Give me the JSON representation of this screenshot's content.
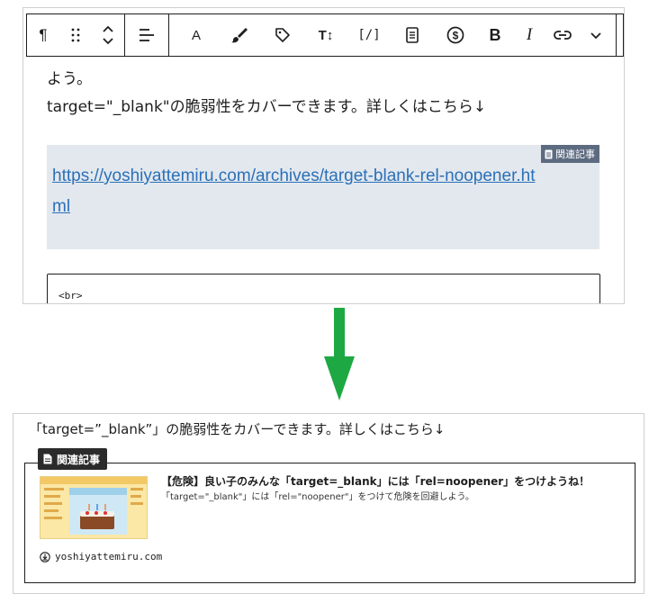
{
  "toolbar": {
    "paragraph_glyph": "¶",
    "drag_glyph": "⠿",
    "align_icon": "align-icon",
    "text_color_glyph": "A",
    "highlight_icon": "brush-icon",
    "tag_icon": "tag-icon",
    "font_size_glyph": "T↕",
    "code_glyph": "[/]",
    "doc_icon": "document-icon",
    "dollar_icon": "dollar-icon",
    "bold_glyph": "B",
    "italic_glyph": "I",
    "link_icon": "link-icon",
    "more_icon": "chevron-down-icon"
  },
  "editor": {
    "line1": "よう。",
    "line2": "target=\"_blank\"の脆弱性をカバーできます。詳しくはこちら↓",
    "related_tag": "関連記事",
    "related_url": "https://yoshiyattemiru.com/archives/target-blank-rel-noopener.html",
    "code_text": "<br>"
  },
  "preview": {
    "text": "「target=”_blank”」の脆弱性をカバーできます。詳しくはこちら↓",
    "card_tag": "関連記事",
    "card_title": "【危険】良い子のみんな「target=_blank」には「rel=noopener」をつけようね！",
    "card_desc": "「target=\"_blank\"」には「rel=\"noopener\"」をつけて危険を回避しよう。",
    "card_site": "yoshiyattemiru.com"
  },
  "colors": {
    "arrow": "#1ea843",
    "link": "#2a70b8",
    "related_bg": "#e3e8ee",
    "related_tag_bg": "#5c6b80",
    "card_tag_bg": "#2b2b2b"
  }
}
